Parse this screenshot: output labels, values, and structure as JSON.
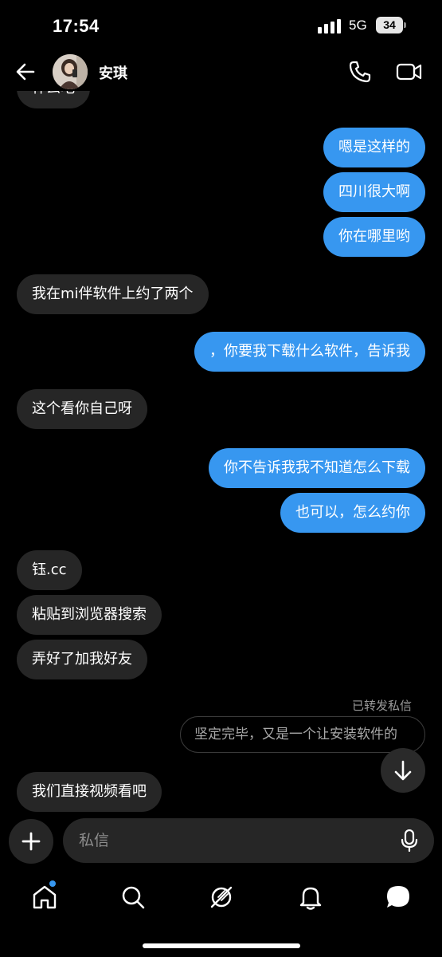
{
  "status_bar": {
    "time": "17:54",
    "network": "5G",
    "battery": "34"
  },
  "header": {
    "contact_name": "安琪"
  },
  "messages": {
    "partial_top": "什么吧",
    "m1": "嗯是这样的",
    "m2": "四川很大啊",
    "m3": "你在哪里哟",
    "m4": "我在mi伴软件上约了两个",
    "m5": "，你要我下载什么软件，告诉我",
    "m6": "这个看你自己呀",
    "m7": "你不告诉我我不知道怎么下载",
    "m8": "也可以，怎么约你",
    "m9": "钰.cc",
    "m10": "粘贴到浏览器搜索",
    "m11": "弄好了加我好友",
    "forward_label": "已转发私信",
    "forward_text": "坚定完毕，又是一个让安装软件的",
    "m12": "我们直接视频看吧"
  },
  "composer": {
    "placeholder": "私信"
  },
  "colors": {
    "accent": "#3797f0",
    "incoming_bubble": "#262626",
    "background": "#000000"
  },
  "icons": [
    "back-arrow-icon",
    "phone-icon",
    "video-camera-icon",
    "arrow-down-icon",
    "plus-icon",
    "microphone-icon",
    "home-icon",
    "search-icon",
    "explore-compass-icon",
    "bell-icon",
    "messages-icon"
  ]
}
